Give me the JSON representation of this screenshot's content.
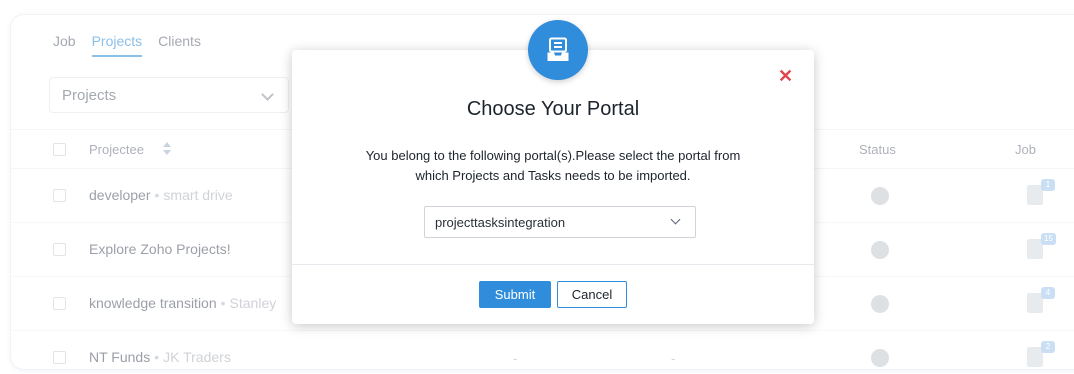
{
  "tabs": [
    {
      "label": "Job"
    },
    {
      "label": "Projects",
      "active": true
    },
    {
      "label": "Clients"
    }
  ],
  "project_filter": {
    "value": "Projects"
  },
  "table": {
    "headers": {
      "name": "Projectee",
      "status": "Status",
      "job": "Job"
    },
    "rows": [
      {
        "name": "developer",
        "sep": "•",
        "client": "smart drive",
        "job_count": "1"
      },
      {
        "name": "Explore Zoho Projects!",
        "sep": "",
        "client": "",
        "job_count": "15"
      },
      {
        "name": "knowledge transition",
        "sep": "•",
        "client": "Stanley",
        "job_count": "4"
      },
      {
        "name": "NT Funds",
        "sep": "•",
        "client": "JK Traders",
        "job_count": "2",
        "cols": [
          "-",
          "-"
        ]
      }
    ]
  },
  "modal": {
    "title": "Choose Your Portal",
    "message_line1": "You belong to the following portal(s).Please select the portal from",
    "message_line2": "which Projects and Tasks needs to be imported.",
    "portal": {
      "selected": "projecttasksintegration"
    },
    "submit_label": "Submit",
    "cancel_label": "Cancel",
    "close_glyph": "✕",
    "icon": "portal-box-icon"
  },
  "colors": {
    "accent": "#2f8ddb",
    "close": "#e0444f"
  }
}
